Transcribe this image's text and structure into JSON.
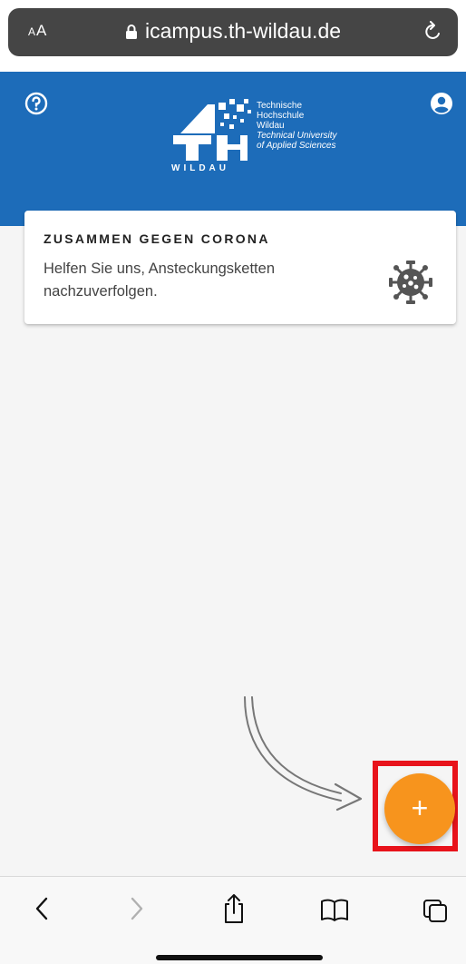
{
  "browser": {
    "text_size_label": "AA",
    "url": "icampus.th-wildau.de",
    "toolbar_icons": [
      "back-icon",
      "forward-icon",
      "share-icon",
      "bookmarks-icon",
      "tabs-icon"
    ]
  },
  "header": {
    "background_color": "#1d6cb9",
    "help_icon": "help-circle-icon",
    "account_icon": "account-circle-icon",
    "logo": {
      "line1": "Technische",
      "line2": "Hochschule",
      "line3": "Wildau",
      "line4": "Technical University",
      "line5": "of Applied Sciences",
      "wordmark": "WILDAU"
    }
  },
  "card": {
    "title": "ZUSAMMEN GEGEN CORONA",
    "text": "Helfen Sie uns, Ansteckungsketten nachzuverfolgen.",
    "icon": "virus-icon"
  },
  "fab": {
    "label": "+",
    "color": "#f7941d"
  },
  "annotation": {
    "highlight_color": "#e8131b"
  }
}
